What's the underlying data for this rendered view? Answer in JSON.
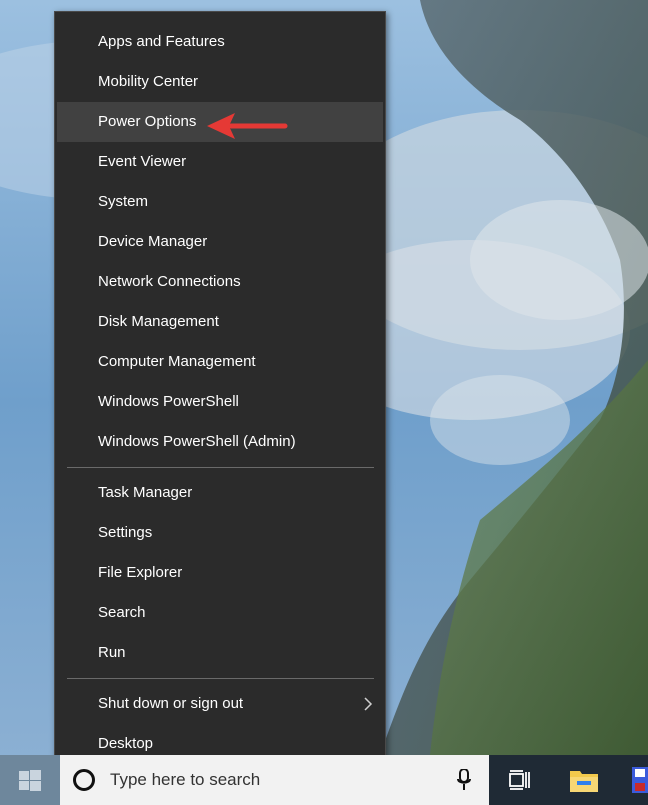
{
  "menu": {
    "items_group1": [
      {
        "label": "Apps and Features"
      },
      {
        "label": "Mobility Center"
      },
      {
        "label": "Power Options"
      },
      {
        "label": "Event Viewer"
      },
      {
        "label": "System"
      },
      {
        "label": "Device Manager"
      },
      {
        "label": "Network Connections"
      },
      {
        "label": "Disk Management"
      },
      {
        "label": "Computer Management"
      },
      {
        "label": "Windows PowerShell"
      },
      {
        "label": "Windows PowerShell (Admin)"
      }
    ],
    "items_group2": [
      {
        "label": "Task Manager"
      },
      {
        "label": "Settings"
      },
      {
        "label": "File Explorer"
      },
      {
        "label": "Search"
      },
      {
        "label": "Run"
      }
    ],
    "items_group3": [
      {
        "label": "Shut down or sign out"
      },
      {
        "label": "Desktop"
      }
    ],
    "highlighted_item": "Power Options"
  },
  "taskbar": {
    "search_placeholder": "Type here to search",
    "icons": [
      "windows-logo-icon",
      "cortana-circle-icon",
      "microphone-icon",
      "task-view-icon",
      "folder-icon",
      "floppy-disk-icon"
    ]
  },
  "colors": {
    "menu_bg": "#2b2b2b",
    "menu_highlight": "#414141",
    "annotation_arrow": "#e53935",
    "taskbar_bg": "#1f2a35",
    "search_box_bg": "#f2f2f2"
  }
}
